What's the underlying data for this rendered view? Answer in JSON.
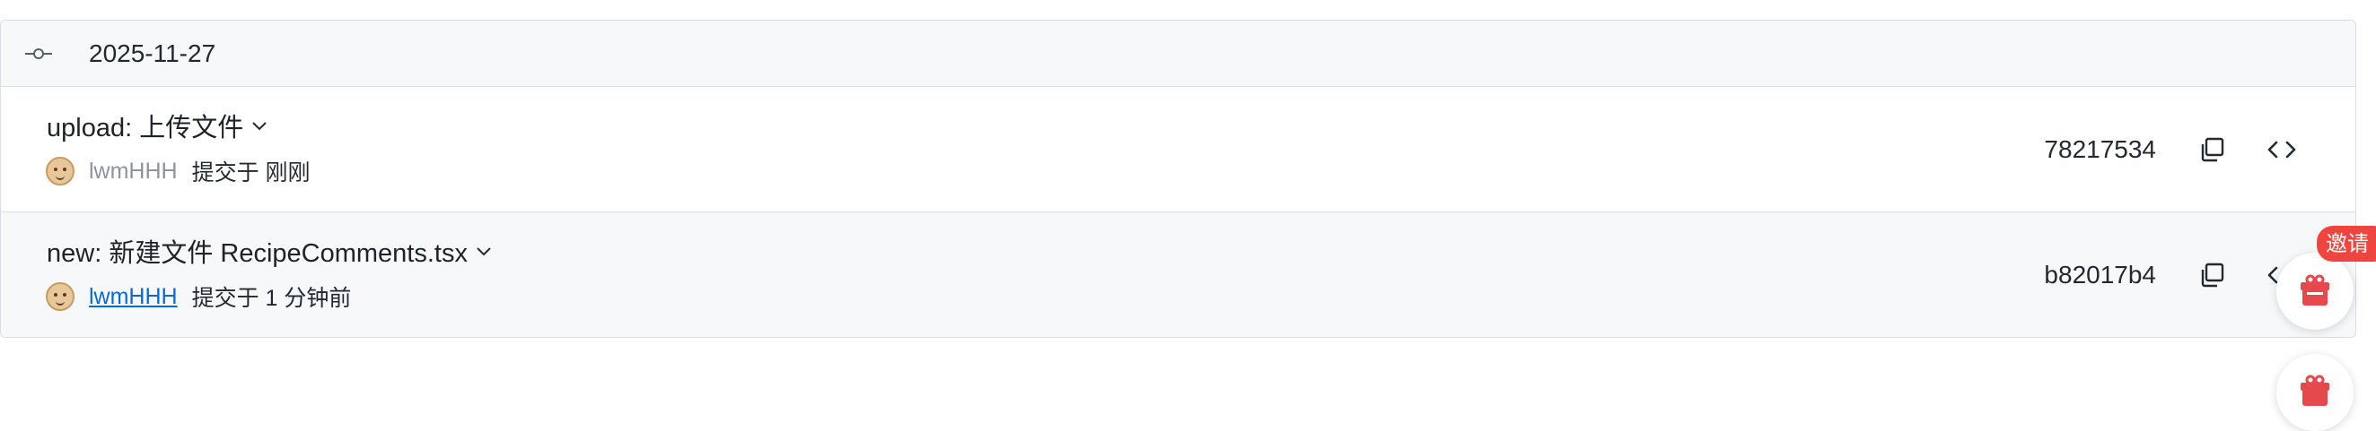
{
  "date_group": {
    "date": "2025-11-27",
    "icon": "git-commit-icon"
  },
  "commits": [
    {
      "message": "upload: 上传文件",
      "author": "lwmHHH",
      "committed_label": "提交于 刚刚",
      "sha": "78217534",
      "copy_icon": "copy-icon",
      "browse_icon": "code-icon"
    },
    {
      "message": "new: 新建文件 RecipeComments.tsx",
      "author": "lwmHHH",
      "committed_label": "提交于 1 分钟前",
      "sha": "b82017b4",
      "copy_icon": "copy-icon",
      "browse_icon": "code-icon"
    }
  ],
  "floating": {
    "invite_label": "邀请",
    "invite_icon": "gift-icon",
    "second_icon": "gift-icon"
  },
  "colors": {
    "border": "#d8dee4",
    "row_alt_bg": "#f6f8fa",
    "link": "#0969da",
    "badge_red": "#f0443f",
    "gift_red": "#e5484d"
  }
}
